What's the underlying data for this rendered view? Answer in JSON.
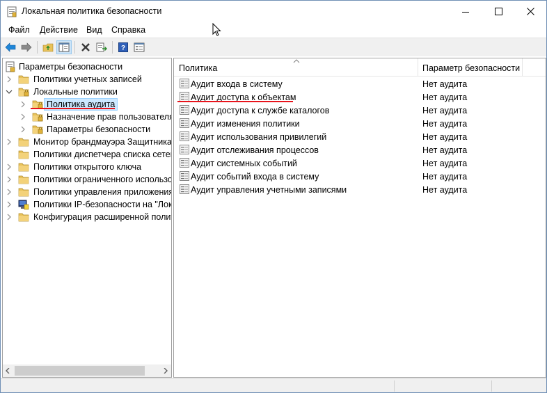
{
  "window": {
    "title": "Локальная политика безопасности"
  },
  "menu": {
    "items": [
      "Файл",
      "Действие",
      "Вид",
      "Справка"
    ]
  },
  "toolbar": {
    "buttons": [
      "back-icon",
      "forward-icon",
      "up-folder-icon",
      "show-tree-icon",
      "delete-icon",
      "export-icon",
      "help-icon",
      "properties-icon"
    ]
  },
  "tree": {
    "root": "Параметры безопасности",
    "items": [
      {
        "label": "Политики учетных записей",
        "expander": "collapsed"
      },
      {
        "label": "Локальные политики",
        "expander": "expanded"
      },
      {
        "label": "Политика аудита",
        "expander": "collapsed",
        "selected": true
      },
      {
        "label": "Назначение прав пользователя",
        "expander": "collapsed"
      },
      {
        "label": "Параметры безопасности",
        "expander": "collapsed"
      },
      {
        "label": "Монитор брандмауэра Защитника Windows",
        "expander": "collapsed"
      },
      {
        "label": "Политики диспетчера списка сетей",
        "expander": "none"
      },
      {
        "label": "Политики открытого ключа",
        "expander": "collapsed"
      },
      {
        "label": "Политики ограниченного использования программ",
        "expander": "collapsed"
      },
      {
        "label": "Политики управления приложениями",
        "expander": "collapsed"
      },
      {
        "label": "Политики IP-безопасности на \"Локальный компьютер\"",
        "expander": "collapsed"
      },
      {
        "label": "Конфигурация расширенной политики аудита",
        "expander": "collapsed"
      }
    ]
  },
  "list": {
    "columns": [
      "Политика",
      "Параметр безопасности"
    ],
    "rows": [
      {
        "policy": "Аудит входа в систему",
        "value": "Нет аудита"
      },
      {
        "policy": "Аудит доступа к объектам",
        "value": "Нет аудита"
      },
      {
        "policy": "Аудит доступа к службе каталогов",
        "value": "Нет аудита"
      },
      {
        "policy": "Аудит изменения политики",
        "value": "Нет аудита"
      },
      {
        "policy": "Аудит использования привилегий",
        "value": "Нет аудита"
      },
      {
        "policy": "Аудит отслеживания процессов",
        "value": "Нет аудита"
      },
      {
        "policy": "Аудит системных событий",
        "value": "Нет аудита"
      },
      {
        "policy": "Аудит событий входа в систему",
        "value": "Нет аудита"
      },
      {
        "policy": "Аудит управления учетными записями",
        "value": "Нет аудита"
      }
    ]
  },
  "colors": {
    "selection": "#cce8ff",
    "annotation": "#e8141c",
    "folder": "#e8c25a"
  }
}
